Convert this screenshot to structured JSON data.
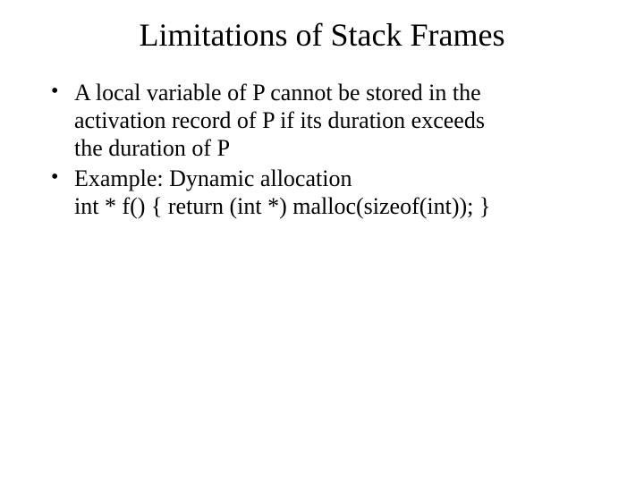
{
  "slide": {
    "title": "Limitations of Stack Frames",
    "bullets": [
      {
        "lines": [
          "A local variable of P cannot be stored in the",
          "activation record of P if its duration exceeds",
          "the duration of P"
        ]
      },
      {
        "lines": [
          "Example: Dynamic allocation",
          "int * f() { return (int *) malloc(sizeof(int)); }"
        ]
      }
    ]
  }
}
